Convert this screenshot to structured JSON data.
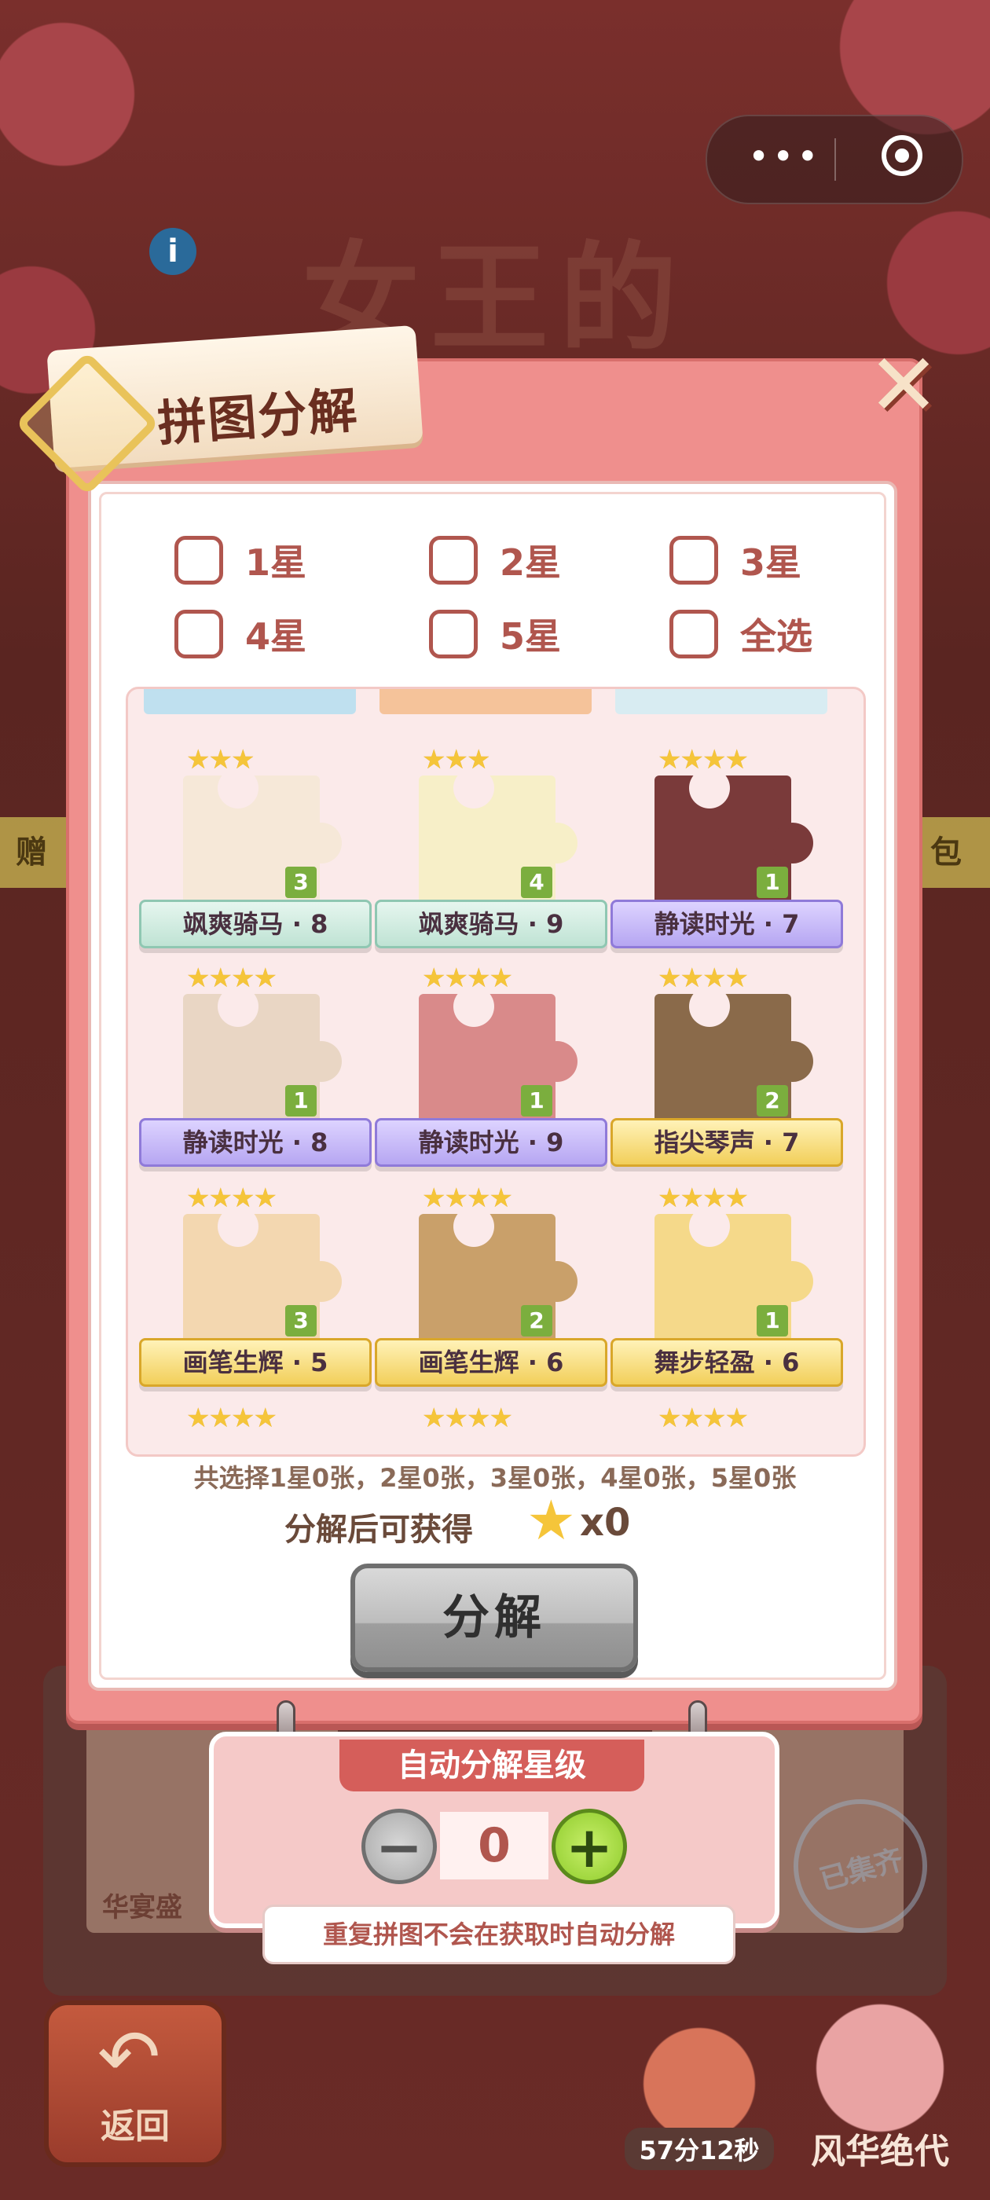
{
  "top_capsule": {
    "more_glyph": "•••",
    "close_glyph": "◎"
  },
  "background": {
    "game_title": "女王的",
    "left_tag": "赠",
    "right_tag": "包",
    "info_glyph": "i",
    "card_label": "华宴盛",
    "stamp": "已集齐"
  },
  "modal": {
    "title": "拼图分解",
    "close_glyph": "✕",
    "filters": [
      {
        "label": "1星",
        "checked": false
      },
      {
        "label": "2星",
        "checked": false
      },
      {
        "label": "3星",
        "checked": false
      },
      {
        "label": "4星",
        "checked": false
      },
      {
        "label": "5星",
        "checked": false
      },
      {
        "label": "全选",
        "checked": false
      }
    ],
    "pieces": [
      {
        "stars": "★★★",
        "name": "飒爽骑马 · 8",
        "count": "3",
        "ribbon": "mint",
        "img": "#f6e8d8"
      },
      {
        "stars": "★★★",
        "name": "飒爽骑马 · 9",
        "count": "4",
        "ribbon": "mint",
        "img": "#f7efc8"
      },
      {
        "stars": "★★★★",
        "name": "静读时光 · 7",
        "count": "1",
        "ribbon": "purple",
        "img": "#7a3a3a"
      },
      {
        "stars": "★★★★",
        "name": "静读时光 · 8",
        "count": "1",
        "ribbon": "purple",
        "img": "#e9d6c4"
      },
      {
        "stars": "★★★★",
        "name": "静读时光 · 9",
        "count": "1",
        "ribbon": "purple",
        "img": "#d98a8a"
      },
      {
        "stars": "★★★★",
        "name": "指尖琴声 · 7",
        "count": "2",
        "ribbon": "gold",
        "img": "#8a6a4a"
      },
      {
        "stars": "★★★★",
        "name": "画笔生辉 · 5",
        "count": "3",
        "ribbon": "gold",
        "img": "#f3d7b0"
      },
      {
        "stars": "★★★★",
        "name": "画笔生辉 · 6",
        "count": "2",
        "ribbon": "gold",
        "img": "#c9a06a"
      },
      {
        "stars": "★★★★",
        "name": "舞步轻盈 · 6",
        "count": "1",
        "ribbon": "gold",
        "img": "#f5d98a"
      }
    ],
    "peek_stars": [
      "★★★★",
      "★★★★",
      "★★★★"
    ],
    "summary": "共选择1星0张，2星0张，3星0张，4星0张，5星0张",
    "obtain_label": "分解后可获得",
    "obtain_star": "★",
    "obtain_value": "x0",
    "decompose_button": "分解"
  },
  "auto_panel": {
    "title": "自动分解星级",
    "minus": "−",
    "value": "0",
    "plus": "+",
    "note": "重复拼图不会在获取时自动分解"
  },
  "bottom": {
    "back_label": "返回",
    "back_glyph": "↶",
    "timer": "57分12秒",
    "character_label": "风华绝代"
  },
  "colors": {
    "modal_bg": "#ef8f8d",
    "accent_red": "#b0564e",
    "star": "#f5c53a",
    "plus_green": "#8fcc2c"
  }
}
